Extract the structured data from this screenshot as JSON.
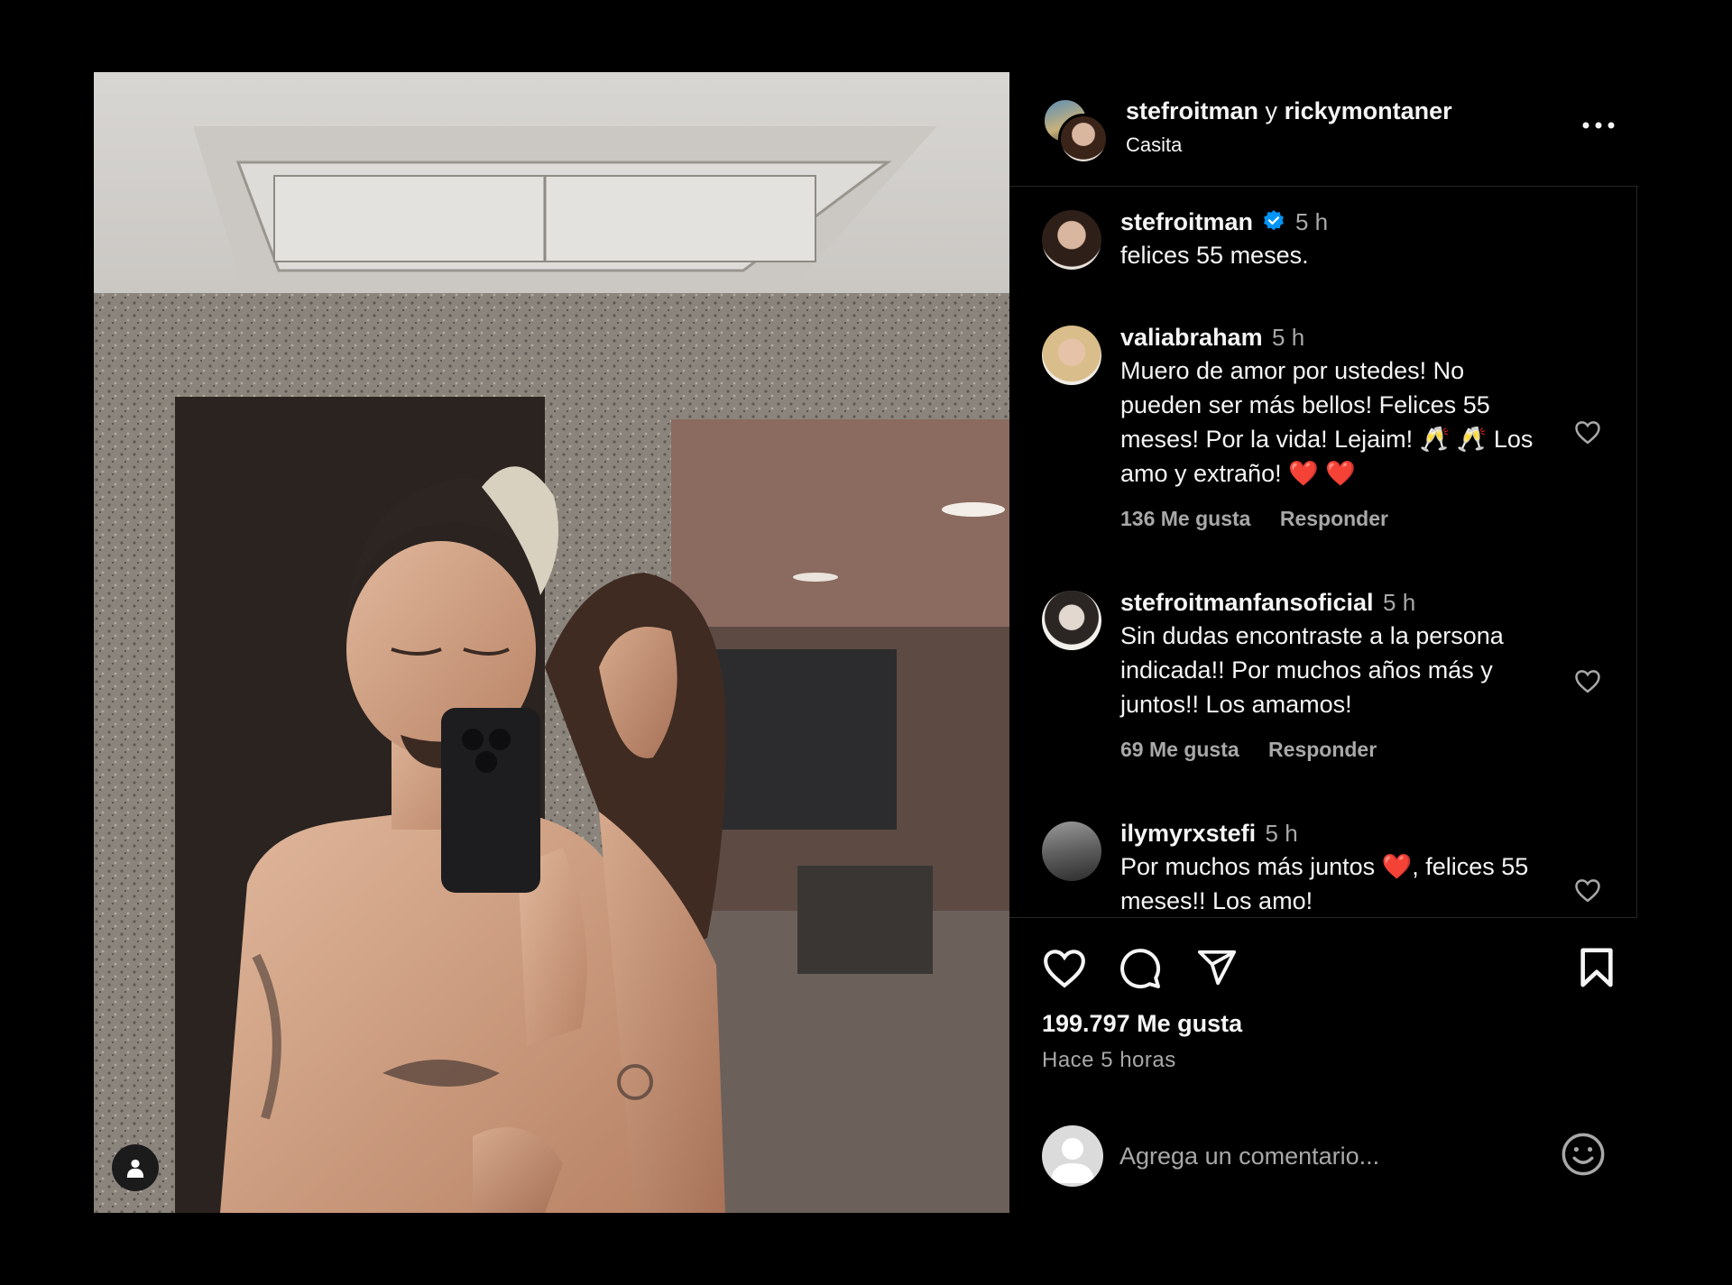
{
  "header": {
    "user1": "stefroitman",
    "connector": "y",
    "user2": "rickymontaner",
    "location": "Casita",
    "more_icon": "more-horizontal-icon"
  },
  "comments": [
    {
      "username": "stefroitman",
      "verified": true,
      "time": "5 h",
      "text": "felices 55 meses."
    },
    {
      "username": "valiabraham",
      "time": "5 h",
      "lines": [
        "Muero de amor por ustedes! No",
        "pueden ser más bellos! Felices 55",
        "meses! Por la vida! Lejaim! 🥂 🥂 Los",
        "amo y extraño! ❤️ ❤️"
      ],
      "likes": "136 Me gusta",
      "reply": "Responder"
    },
    {
      "username": "stefroitmanfansoficial",
      "time": "5 h",
      "lines": [
        "Sin dudas encontraste a la persona",
        "indicada!! Por muchos años más y",
        "juntos!! Los amamos!"
      ],
      "likes": "69 Me gusta",
      "reply": "Responder"
    },
    {
      "username": "ilymyrxstefi",
      "time": "5 h",
      "lines": [
        "Por muchos más juntos ❤️, felices 55",
        "meses!! Los amo!"
      ]
    }
  ],
  "actions": {
    "like_icon": "heart-icon",
    "comment_icon": "comment-icon",
    "share_icon": "send-icon",
    "save_icon": "bookmark-icon"
  },
  "likes_count": "199.797 Me gusta",
  "time_ago": "Hace 5 horas",
  "add_comment": {
    "placeholder": "Agrega un comentario...",
    "emoji_icon": "smiley-icon"
  },
  "colors": {
    "background": "#000000",
    "text": "#f5f5f5",
    "secondary_text": "#a8a8a8",
    "verified_badge": "#0095f6",
    "divider": "#262626"
  }
}
